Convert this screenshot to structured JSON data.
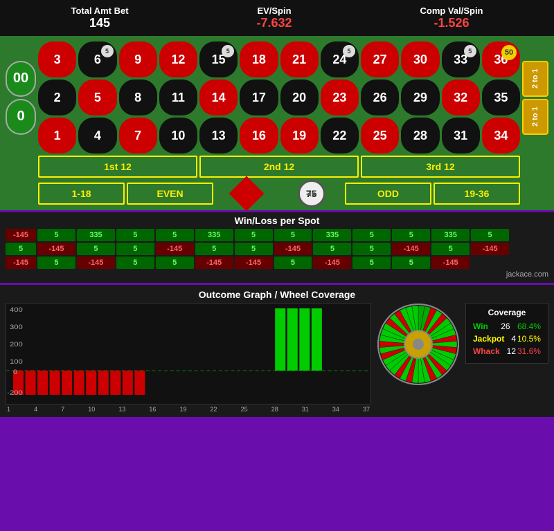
{
  "stats": {
    "label1": "Total Amt Bet",
    "val1": "145",
    "label2": "EV/Spin",
    "val2": "-7.632",
    "label3": "Comp Val/Spin",
    "val3": "-1.526"
  },
  "roulette": {
    "zeros": [
      "00",
      "0"
    ],
    "numbers": [
      {
        "n": "3",
        "c": "red"
      },
      {
        "n": "6",
        "c": "black",
        "chip": "5"
      },
      {
        "n": "9",
        "c": "red"
      },
      {
        "n": "12",
        "c": "red"
      },
      {
        "n": "15",
        "c": "black",
        "chip": "5"
      },
      {
        "n": "18",
        "c": "red"
      },
      {
        "n": "21",
        "c": "red"
      },
      {
        "n": "24",
        "c": "black",
        "chip": "5"
      },
      {
        "n": "27",
        "c": "red"
      },
      {
        "n": "30",
        "c": "red"
      },
      {
        "n": "33",
        "c": "black",
        "chip": "5"
      },
      {
        "n": "36",
        "c": "red",
        "chip": "50"
      },
      {
        "n": "2",
        "c": "black"
      },
      {
        "n": "5",
        "c": "red"
      },
      {
        "n": "8",
        "c": "black"
      },
      {
        "n": "11",
        "c": "black"
      },
      {
        "n": "14",
        "c": "red"
      },
      {
        "n": "17",
        "c": "black"
      },
      {
        "n": "20",
        "c": "black"
      },
      {
        "n": "23",
        "c": "red"
      },
      {
        "n": "26",
        "c": "black"
      },
      {
        "n": "29",
        "c": "black"
      },
      {
        "n": "32",
        "c": "red"
      },
      {
        "n": "35",
        "c": "black"
      },
      {
        "n": "1",
        "c": "red"
      },
      {
        "n": "4",
        "c": "black"
      },
      {
        "n": "7",
        "c": "red"
      },
      {
        "n": "10",
        "c": "black"
      },
      {
        "n": "13",
        "c": "black"
      },
      {
        "n": "16",
        "c": "red"
      },
      {
        "n": "19",
        "c": "red"
      },
      {
        "n": "22",
        "c": "black"
      },
      {
        "n": "25",
        "c": "red"
      },
      {
        "n": "28",
        "c": "black"
      },
      {
        "n": "31",
        "c": "black"
      },
      {
        "n": "34",
        "c": "red"
      }
    ],
    "side_bets": [
      "2 to 1",
      "2 to 1"
    ],
    "dozens": [
      "1st 12",
      "2nd 12",
      "3rd 12"
    ],
    "bottom": [
      "1-18",
      "EVEN",
      "ODD",
      "19-36"
    ],
    "chip_value": "75"
  },
  "winloss": {
    "title": "Win/Loss per Spot",
    "rows": [
      [
        "-145",
        "5",
        "335",
        "5",
        "5",
        "335",
        "5",
        "5",
        "335",
        "5",
        "5",
        "335",
        "5"
      ],
      [
        "",
        "5",
        "-145",
        "5",
        "5",
        "-145",
        "5",
        "5",
        "-145",
        "5",
        "5",
        "-145",
        "5"
      ],
      [
        "-145",
        "",
        "-145",
        "5",
        "-145",
        "5",
        "5",
        "-145",
        "-145",
        "5",
        "-145",
        "5",
        "5",
        "-145"
      ]
    ],
    "credit": "jackace.com"
  },
  "outcome": {
    "title": "Outcome Graph / Wheel Coverage",
    "y_labels": [
      "400",
      "300",
      "200",
      "100",
      "0",
      "-200"
    ],
    "x_labels": [
      "1",
      "4",
      "7",
      "10",
      "13",
      "16",
      "19",
      "22",
      "25",
      "28",
      "31",
      "34",
      "37"
    ],
    "coverage": {
      "title": "Coverage",
      "win_label": "Win",
      "win_count": "26",
      "win_pct": "68.4%",
      "jackpot_label": "Jackpot",
      "jackpot_count": "4",
      "jackpot_pct": "10.5%",
      "whack_label": "Whack",
      "whack_count": "12",
      "whack_pct": "31.6%"
    }
  }
}
